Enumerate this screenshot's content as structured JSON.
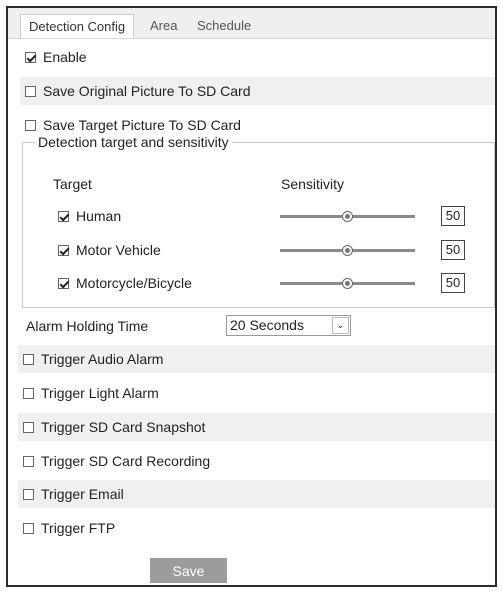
{
  "tabs": [
    "Detection Config",
    "Area",
    "Schedule"
  ],
  "options": {
    "enable": {
      "label": "Enable",
      "checked": true
    },
    "save_original": {
      "label": "Save Original Picture To SD Card",
      "checked": false
    },
    "save_target": {
      "label": "Save Target Picture To SD Card",
      "checked": false
    }
  },
  "detection": {
    "legend": "Detection target and sensitivity",
    "col_target": "Target",
    "col_sensitivity": "Sensitivity",
    "targets": [
      {
        "label": "Human",
        "checked": true,
        "sensitivity": "50"
      },
      {
        "label": "Motor Vehicle",
        "checked": true,
        "sensitivity": "50"
      },
      {
        "label": "Motorcycle/Bicycle",
        "checked": true,
        "sensitivity": "50"
      }
    ]
  },
  "alarm_holding": {
    "label": "Alarm Holding Time",
    "value": "20 Seconds"
  },
  "triggers": [
    {
      "label": "Trigger Audio Alarm",
      "checked": false
    },
    {
      "label": "Trigger Light Alarm",
      "checked": false
    },
    {
      "label": "Trigger SD Card Snapshot",
      "checked": false
    },
    {
      "label": "Trigger SD Card Recording",
      "checked": false
    },
    {
      "label": "Trigger Email",
      "checked": false
    },
    {
      "label": "Trigger FTP",
      "checked": false
    }
  ],
  "save_label": "Save"
}
